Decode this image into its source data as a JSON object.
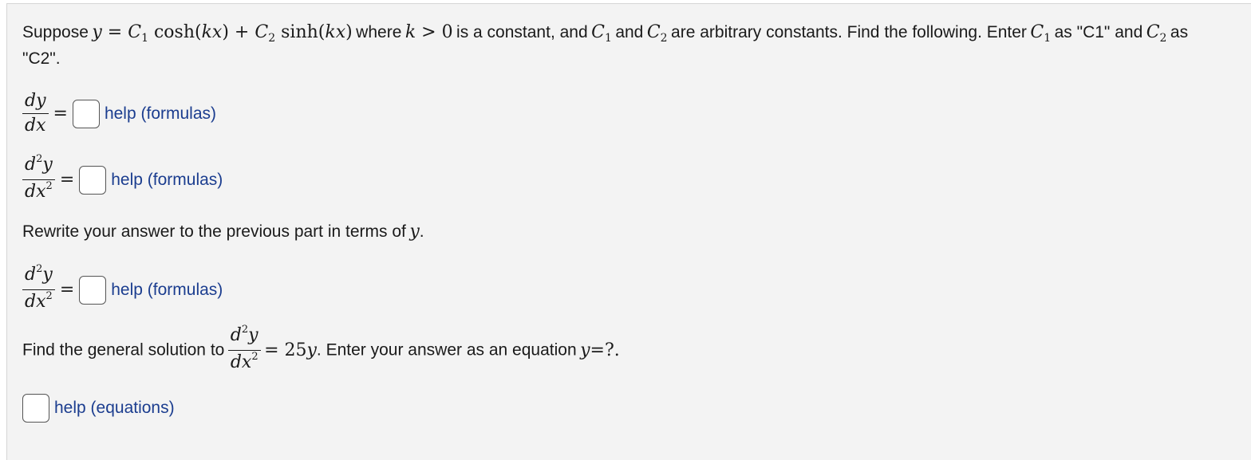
{
  "problem": {
    "intro_suppose": "Suppose",
    "intro_where": "where",
    "intro_constant": "is a constant, and",
    "intro_and": "and",
    "intro_arbitrary": "are arbitrary constants. Find the following. Enter",
    "intro_as1": "as \"C1\" and",
    "intro_as2": "as",
    "intro_line2": "\"C2\".",
    "rewrite_text": "Rewrite your answer to the previous part in terms of",
    "general_prefix": "Find the general solution to",
    "general_suffix": ". Enter your answer as an equation",
    "rhs_25y": "= 25",
    "eq_end": "=?."
  },
  "answers": [
    {
      "help_label": "help (formulas)"
    },
    {
      "help_label": "help (formulas)"
    },
    {
      "help_label": "help (formulas)"
    },
    {
      "help_label": "help (equations)"
    }
  ]
}
